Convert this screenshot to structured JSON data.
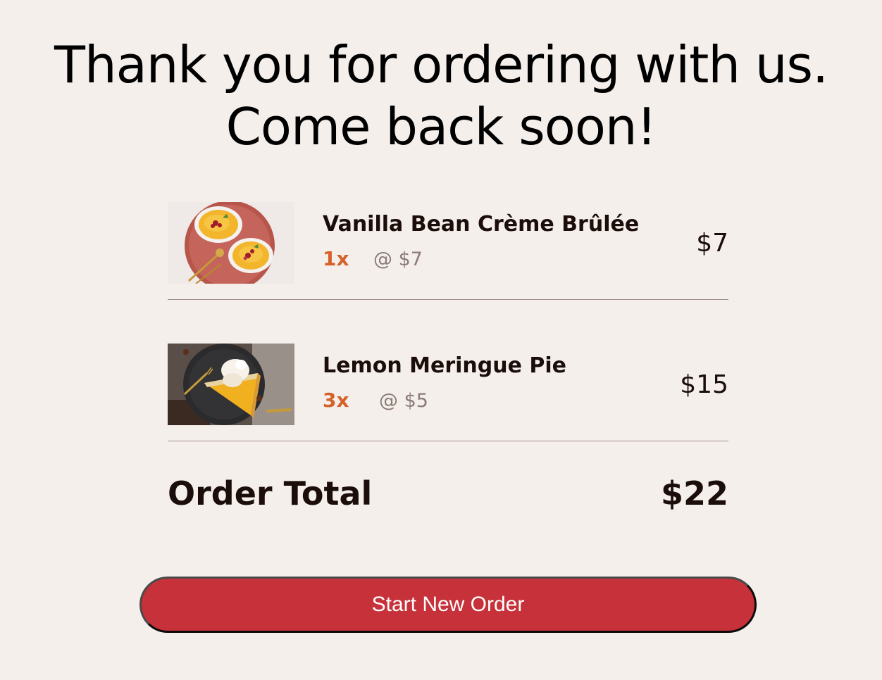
{
  "header": {
    "line1": "Thank you for ordering with us.",
    "line2": "Come back soon!"
  },
  "order": {
    "items": [
      {
        "name": "Vanilla Bean Crème Brûlée",
        "qty": "1x",
        "unit_price": "@ $7",
        "price": "$7",
        "image_icon": "creme-brulee-image"
      },
      {
        "name": "Lemon Meringue Pie",
        "qty": "3x",
        "unit_price": "@ $5",
        "price": "$15",
        "image_icon": "lemon-meringue-pie-image"
      }
    ],
    "total_label": "Order Total",
    "total_value": "$22"
  },
  "actions": {
    "start_new_order": "Start New Order"
  },
  "colors": {
    "background": "#f5efec",
    "accent_qty": "#d5622a",
    "button": "#c6313a",
    "text_dark": "#1b0e0a",
    "text_muted": "#8a7b76"
  }
}
